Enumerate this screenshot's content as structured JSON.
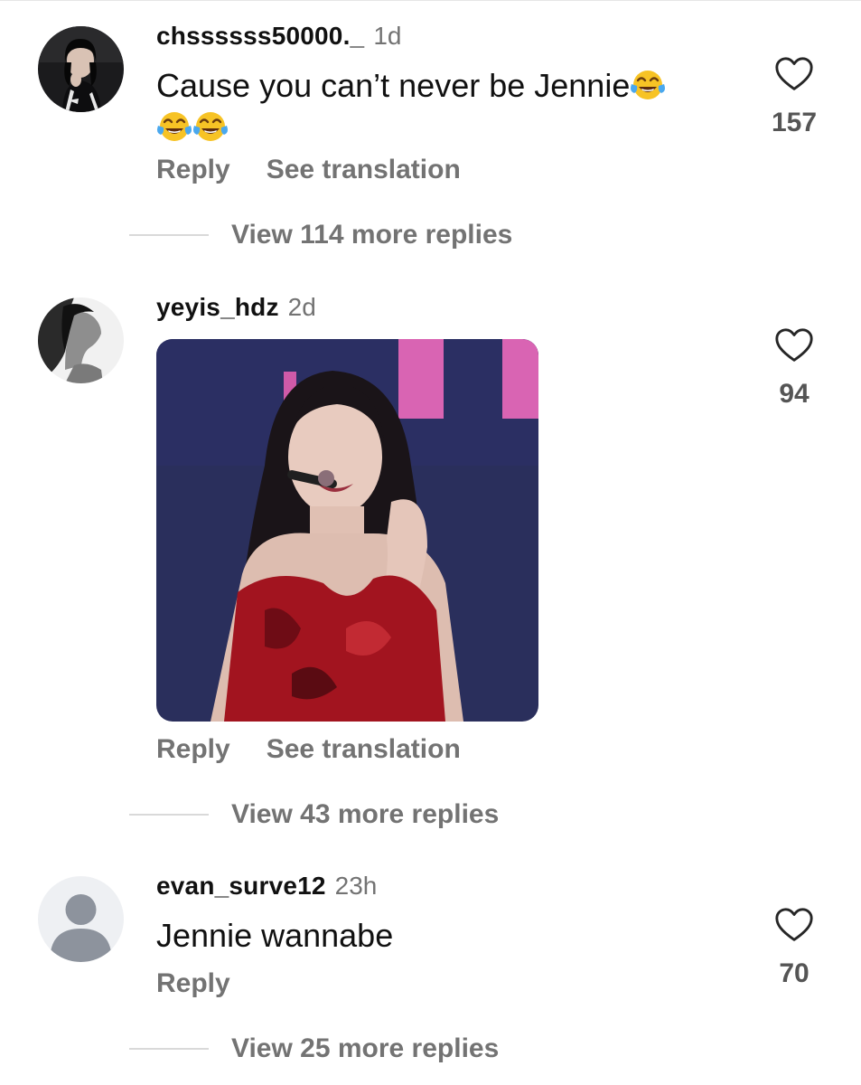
{
  "comments": [
    {
      "username": "chssssss50000._",
      "time": "1d",
      "text": "Cause you can’t never be Jennie",
      "emoji_name": "face-with-tears-of-joy",
      "emoji_count": 3,
      "actions": [
        "Reply",
        "See translation"
      ],
      "likes": "157",
      "view_replies": "View 114 more replies"
    },
    {
      "username": "yeyis_hdz",
      "time": "2d",
      "media": "photo",
      "actions": [
        "Reply",
        "See translation"
      ],
      "likes": "94",
      "view_replies": "View 43 more replies"
    },
    {
      "username": "evan_surve12",
      "time": "23h",
      "text": "Jennie wannabe",
      "actions": [
        "Reply"
      ],
      "likes": "70",
      "view_replies": "View 25 more replies"
    }
  ],
  "icons": {
    "like": "heart-outline-icon",
    "default_avatar": "person-placeholder-icon"
  },
  "colors": {
    "text_primary": "#111111",
    "text_secondary": "#737373",
    "divider": "#d9d9d9",
    "placeholder_avatar_bg": "#eef0f3",
    "placeholder_avatar_fg": "#8d939d"
  }
}
